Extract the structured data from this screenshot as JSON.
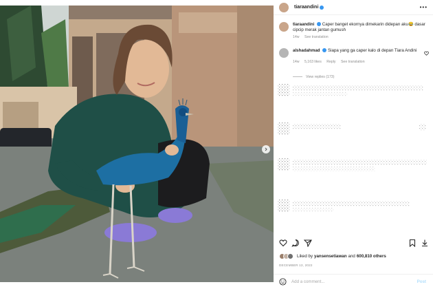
{
  "post": {
    "author": "tiaraandini",
    "more_icon": "more-dots-icon"
  },
  "caption": {
    "author": "tiaraandini",
    "text": "Caper banget ekornya dimekarin didepan aku😂 dasar cipcip merak jantan gumush",
    "age": "14w",
    "translate": "See translation"
  },
  "comment": {
    "author": "alshadahmad",
    "text": "Siapa yang ga caper kalo di depan Tiara Andini",
    "age": "14w",
    "likes": "5,163 likes",
    "reply": "Reply",
    "translate": "See translation",
    "view_replies": "View replies (173)"
  },
  "likes": {
    "prefix": "Liked by",
    "user": "yansensetiawan",
    "and": "and",
    "count": "600,810 others"
  },
  "date": "DECEMBER 13, 2022",
  "add_comment": {
    "placeholder": "Add a comment...",
    "post_label": "Post"
  },
  "colors": {
    "verified": "#3897f0",
    "post_disabled": "#b2dffc",
    "secondary_text": "#8e8e8e"
  },
  "icons": [
    "heart-icon",
    "comment-icon",
    "share-icon",
    "bookmark-icon",
    "download-icon",
    "emoji-icon",
    "chevron-right-icon",
    "verified-badge-icon"
  ]
}
